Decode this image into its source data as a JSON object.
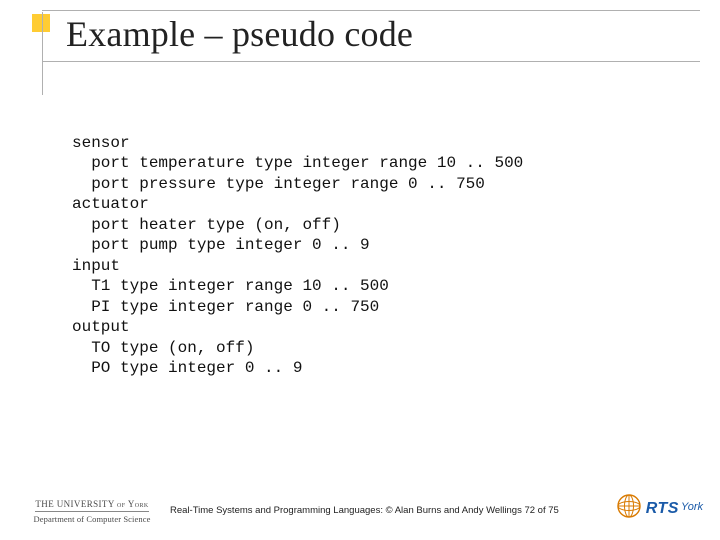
{
  "title": "Example – pseudo code",
  "code": "sensor\n  port temperature type integer range 10 .. 500\n  port pressure type integer range 0 .. 750\nactuator\n  port heater type (on, off)\n  port pump type integer 0 .. 9\ninput\n  T1 type integer range 10 .. 500\n  PI type integer range 0 .. 750\noutput\n  TO type (on, off)\n  PO type integer 0 .. 9",
  "footer": {
    "uni_name": "THE UNIVERSITY of York",
    "dept_name": "Department of Computer Science",
    "caption": "Real-Time Systems and Programming Languages: © Alan Burns and Andy Wellings 72 of 75",
    "rts_label": "RTS",
    "york_label": "York"
  }
}
